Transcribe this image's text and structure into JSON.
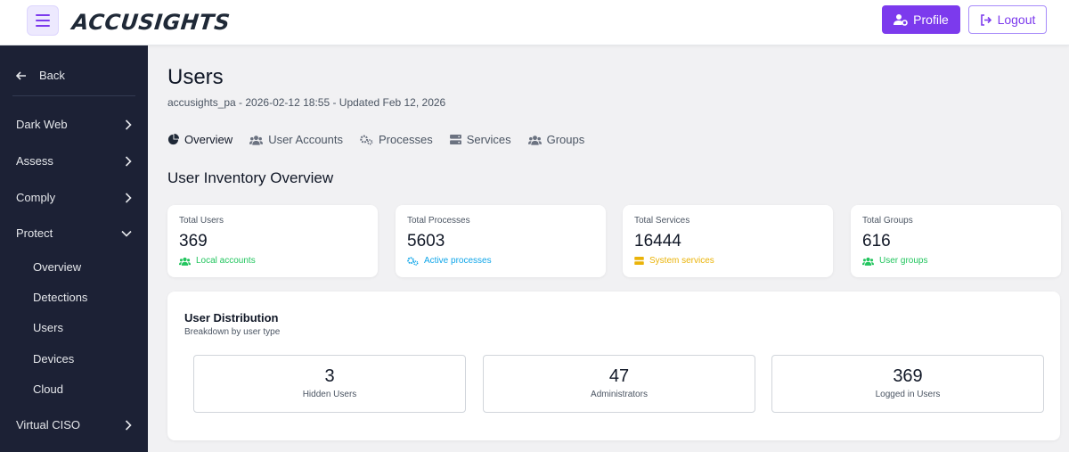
{
  "header": {
    "logo": "ACCUSIGHTS",
    "profile_label": "Profile",
    "logout_label": "Logout",
    "accent": "#7c3aed"
  },
  "sidebar": {
    "back_label": "Back",
    "items": [
      {
        "label": "Dark Web",
        "expanded": false
      },
      {
        "label": "Assess",
        "expanded": false
      },
      {
        "label": "Comply",
        "expanded": false
      },
      {
        "label": "Protect",
        "expanded": true,
        "children": [
          "Overview",
          "Detections",
          "Users",
          "Devices",
          "Cloud"
        ]
      },
      {
        "label": "Virtual CISO",
        "expanded": false
      }
    ]
  },
  "main": {
    "title": "Users",
    "subtitle": "accusights_pa - 2026-02-12 18:55 - Updated Feb 12, 2026",
    "tabs": [
      {
        "label": "Overview",
        "icon": "pie-chart-icon",
        "active": true
      },
      {
        "label": "User Accounts",
        "icon": "users-icon",
        "active": false
      },
      {
        "label": "Processes",
        "icon": "cogs-icon",
        "active": false
      },
      {
        "label": "Services",
        "icon": "server-icon",
        "active": false
      },
      {
        "label": "Groups",
        "icon": "group-icon",
        "active": false
      }
    ],
    "section_title": "User Inventory Overview",
    "stats": [
      {
        "label": "Total Users",
        "value": "369",
        "foot": "Local accounts",
        "color": "#22c55e",
        "icon": "users-icon"
      },
      {
        "label": "Total Processes",
        "value": "5603",
        "foot": "Active processes",
        "color": "#0ea5e9",
        "icon": "cogs-icon"
      },
      {
        "label": "Total Services",
        "value": "16444",
        "foot": "System services",
        "color": "#eab308",
        "icon": "server-icon"
      },
      {
        "label": "Total Groups",
        "value": "616",
        "foot": "User groups",
        "color": "#22c55e",
        "icon": "group-icon"
      }
    ],
    "distribution": {
      "title": "User Distribution",
      "subtitle": "Breakdown by user type",
      "items": [
        {
          "value": "3",
          "label": "Hidden Users"
        },
        {
          "value": "47",
          "label": "Administrators"
        },
        {
          "value": "369",
          "label": "Logged in Users"
        }
      ]
    }
  }
}
